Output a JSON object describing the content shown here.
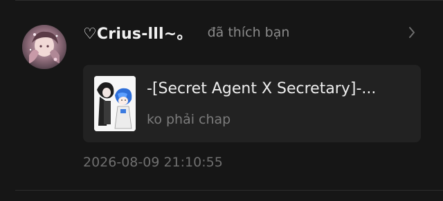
{
  "notification": {
    "username": "♡Crius-lll~。",
    "action": "đã thích bạn",
    "card": {
      "title": "-[Secret Agent X Secretary]-...",
      "subtitle": "ko phải chap"
    },
    "timestamp": "2026-08-09 21:10:55",
    "icons": {
      "avatar": "user-avatar-icon",
      "chevron": "chevron-right-icon",
      "cover": "story-cover-image"
    }
  },
  "colors": {
    "background": "#161616",
    "card": "#222222",
    "primary_text": "#eeeeee",
    "secondary_text": "#8a8a8a",
    "timestamp_text": "#6f6f6f"
  }
}
